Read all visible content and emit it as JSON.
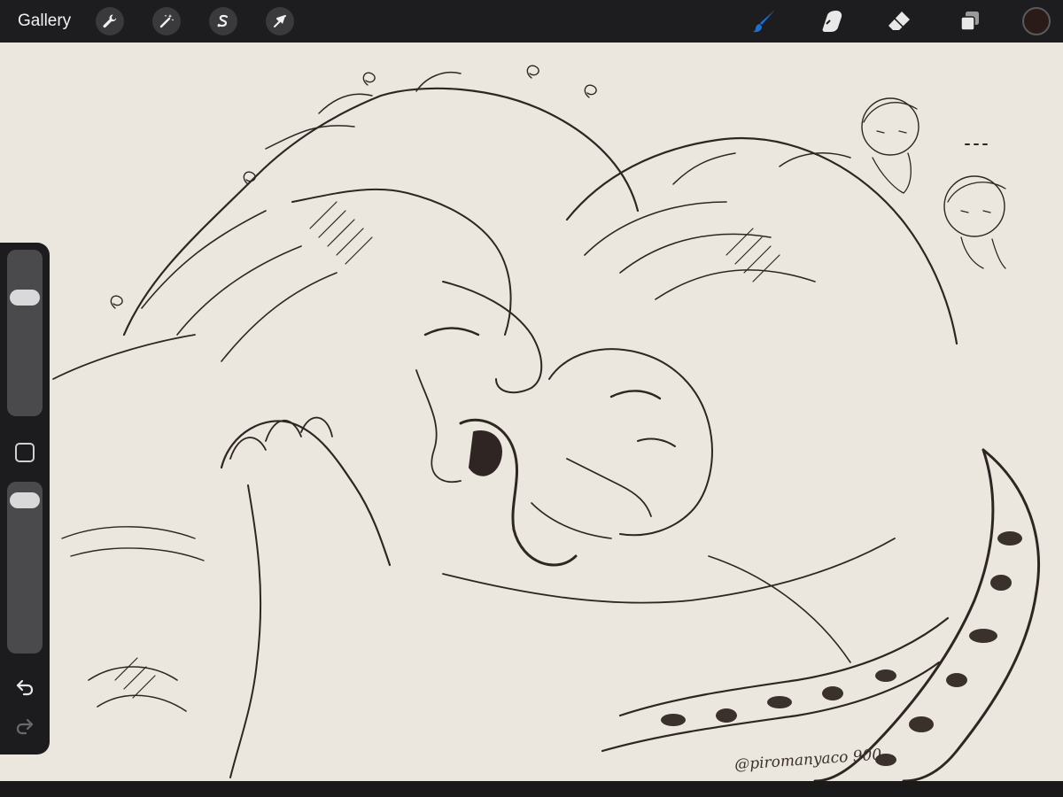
{
  "app": {
    "gallery_label": "Gallery"
  },
  "toolbar_left": [
    {
      "name": "actions",
      "icon": "wrench-icon"
    },
    {
      "name": "adjustments",
      "icon": "magic-wand-icon"
    },
    {
      "name": "selection",
      "icon": "selection-s-icon"
    },
    {
      "name": "transform",
      "icon": "arrow-cursor-icon"
    }
  ],
  "toolbar_right": [
    {
      "name": "brush",
      "icon": "brush-icon",
      "active": true
    },
    {
      "name": "smudge",
      "icon": "smudge-finger-icon",
      "active": false
    },
    {
      "name": "eraser",
      "icon": "eraser-icon",
      "active": false
    },
    {
      "name": "layers",
      "icon": "layers-icon",
      "active": false
    }
  ],
  "colors": {
    "active_tool": "#1a6fd8",
    "current_color": "#2a1a18",
    "canvas_paper": "#ebe7df",
    "ink": "#2f2623"
  },
  "sidebar": {
    "brush_size_level": 0.75,
    "opacity_level": 0.95,
    "undo_icon": "undo-icon",
    "redo_icon": "redo-icon"
  },
  "canvas": {
    "signature": "@piromanyaco 900"
  }
}
